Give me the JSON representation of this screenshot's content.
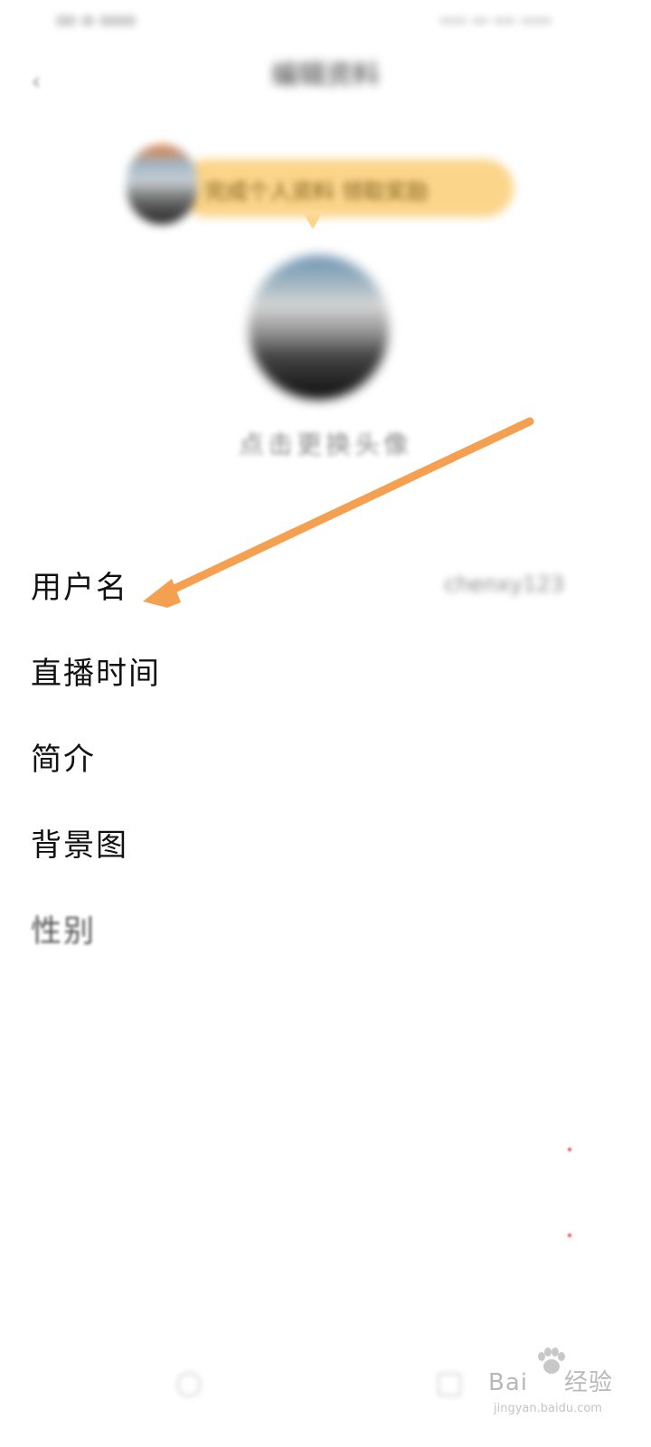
{
  "status_bar": {
    "left_text": "",
    "right_text": ""
  },
  "header": {
    "title": "编辑资料",
    "subtitle": "",
    "subtitle_accent": ""
  },
  "promo": {
    "text": "完成个人资料 领取奖励"
  },
  "avatar": {
    "hint": "点击更换头像"
  },
  "settings": {
    "rows": [
      {
        "label": "用户名",
        "value": "chenxy123"
      },
      {
        "label": "直播时间",
        "value": ""
      },
      {
        "label": "简介",
        "value": ""
      },
      {
        "label": "背景图",
        "value": ""
      },
      {
        "label": "性别",
        "value": ""
      },
      {
        "label": "",
        "value": ""
      },
      {
        "label": "",
        "value": ""
      },
      {
        "label": "",
        "value": ""
      },
      {
        "label": "",
        "value": ""
      }
    ]
  },
  "annotation": {
    "arrow_color": "#F5A050"
  },
  "watermark": {
    "brand_left": "Bai",
    "brand_right": "经验",
    "url": "jingyan.baidu.com"
  },
  "colors": {
    "background": "#FFFFFF",
    "promo_bg": "#FBD58A",
    "accent_dot": "#E04A4A"
  }
}
